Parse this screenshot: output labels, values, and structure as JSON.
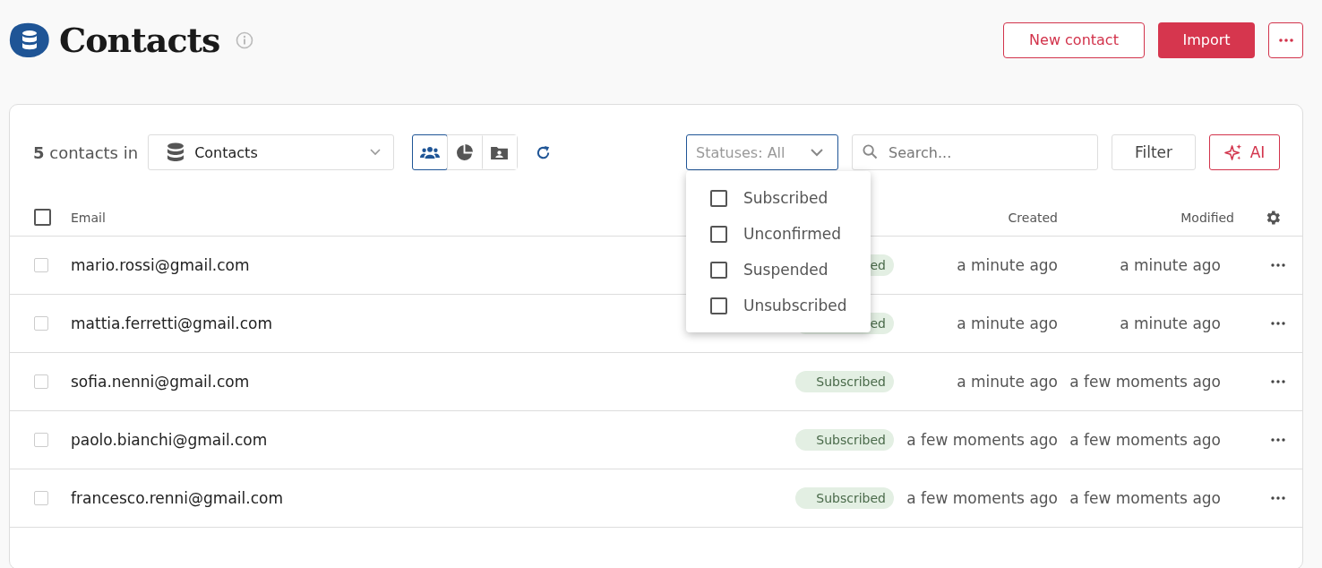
{
  "header": {
    "title": "Contacts",
    "actions": [
      {
        "kind": "outline",
        "label": "New contact"
      },
      {
        "kind": "primary",
        "label": "Import"
      },
      {
        "kind": "more"
      }
    ]
  },
  "toolbar": {
    "count": "5",
    "count_suffix": "contacts in",
    "list_select": {
      "value": "Contacts"
    },
    "views": [
      {
        "kind": "people",
        "selected": true
      },
      {
        "kind": "chart",
        "selected": false
      },
      {
        "kind": "card",
        "selected": false
      }
    ],
    "status_filter": {
      "placeholder": "Statuses: All",
      "expanded": true,
      "options": [
        {
          "label": "Subscribed",
          "checked": false
        },
        {
          "label": "Unconfirmed",
          "checked": false
        },
        {
          "label": "Suspended",
          "checked": false
        },
        {
          "label": "Unsubscribed",
          "checked": false
        }
      ]
    },
    "search": {
      "placeholder": "Search..."
    },
    "filter_button": "Filter",
    "ai_button": "AI"
  },
  "table": {
    "columns": {
      "email": "Email",
      "created": "Created",
      "modified": "Modified"
    },
    "all_checked": false,
    "rows": [
      {
        "checked": false,
        "email": "mario.rossi@gmail.com",
        "status": "ed",
        "created": "a minute ago",
        "modified": "a minute ago"
      },
      {
        "checked": false,
        "email": "mattia.ferretti@gmail.com",
        "status": "ed",
        "created": "a minute ago",
        "modified": "a minute ago"
      },
      {
        "checked": false,
        "email": "sofia.nenni@gmail.com",
        "status": "Subscribed",
        "created": "a minute ago",
        "modified": "a few moments ago"
      },
      {
        "checked": false,
        "email": "paolo.bianchi@gmail.com",
        "status": "Subscribed",
        "created": "a few moments ago",
        "modified": "a few moments ago"
      },
      {
        "checked": false,
        "email": "francesco.renni@gmail.com",
        "status": "Subscribed",
        "created": "a few moments ago",
        "modified": "a few moments ago"
      }
    ]
  }
}
